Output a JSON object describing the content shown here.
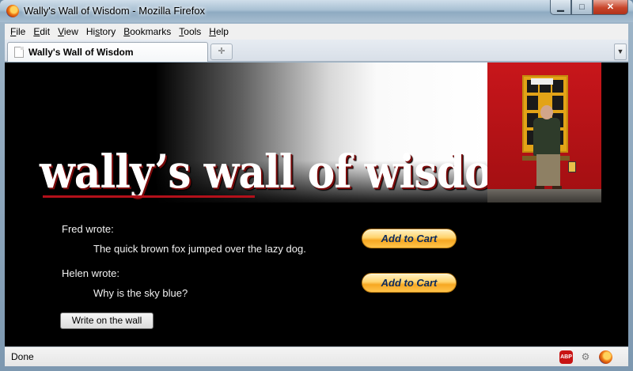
{
  "window": {
    "title": "Wally's Wall of Wisdom - Mozilla Firefox",
    "minimize_glyph": "▁",
    "maximize_glyph": "□",
    "close_glyph": "✕"
  },
  "menubar": {
    "items": [
      {
        "label": "File",
        "accel": "F",
        "rest": "ile"
      },
      {
        "label": "Edit",
        "accel": "E",
        "rest": "dit"
      },
      {
        "label": "View",
        "accel": "V",
        "rest": "iew"
      },
      {
        "label": "History",
        "accel": "",
        "pre": "Hi",
        "u": "s",
        "post": "tory"
      },
      {
        "label": "Bookmarks",
        "accel": "B",
        "rest": "ookmarks"
      },
      {
        "label": "Tools",
        "accel": "T",
        "rest": "ools"
      },
      {
        "label": "Help",
        "accel": "H",
        "rest": "elp"
      }
    ]
  },
  "tabs": [
    {
      "label": "Wally's Wall of Wisdom",
      "active": true
    }
  ],
  "page": {
    "banner_title": "wally’s wall of wisdom",
    "posts": [
      {
        "author_line": "Fred wrote:",
        "message": "The quick brown fox jumped over the lazy dog.",
        "cart_label": "Add to Cart"
      },
      {
        "author_line": "Helen wrote:",
        "message": "Why is the sky blue?",
        "cart_label": "Add to Cart"
      }
    ],
    "write_button_label": "Write on the wall"
  },
  "statusbar": {
    "text": "Done",
    "abp_label": "ABP"
  },
  "colors": {
    "banner_title_shadow": "#7a0b0b",
    "underline": "#b3101a",
    "cart_button": "#ffc44a",
    "cart_text": "#0c2a5c",
    "photo_wall": "#c8161b"
  }
}
